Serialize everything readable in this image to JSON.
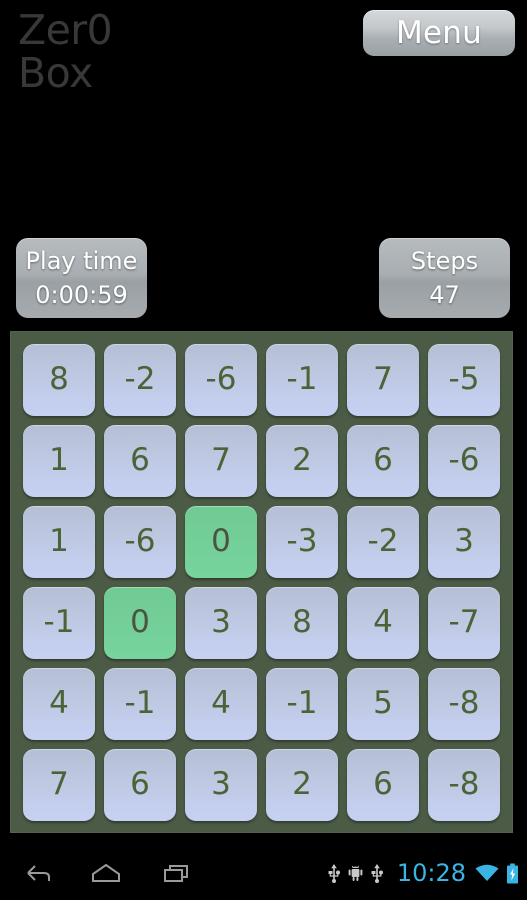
{
  "app": {
    "title_line1": "Zer0",
    "title_line2": "Box"
  },
  "header": {
    "menu_label": "Menu"
  },
  "stats": {
    "playtime_label": "Play time",
    "playtime_value": "0:00:59",
    "steps_label": "Steps",
    "steps_value": "47"
  },
  "board": {
    "rows": 6,
    "cols": 6,
    "cells": [
      [
        {
          "v": "8",
          "zero": false
        },
        {
          "v": "-2",
          "zero": false
        },
        {
          "v": "-6",
          "zero": false
        },
        {
          "v": "-1",
          "zero": false
        },
        {
          "v": "7",
          "zero": false
        },
        {
          "v": "-5",
          "zero": false
        }
      ],
      [
        {
          "v": "1",
          "zero": false
        },
        {
          "v": "6",
          "zero": false
        },
        {
          "v": "7",
          "zero": false
        },
        {
          "v": "2",
          "zero": false
        },
        {
          "v": "6",
          "zero": false
        },
        {
          "v": "-6",
          "zero": false
        }
      ],
      [
        {
          "v": "1",
          "zero": false
        },
        {
          "v": "-6",
          "zero": false
        },
        {
          "v": "0",
          "zero": true
        },
        {
          "v": "-3",
          "zero": false
        },
        {
          "v": "-2",
          "zero": false
        },
        {
          "v": "3",
          "zero": false
        }
      ],
      [
        {
          "v": "-1",
          "zero": false
        },
        {
          "v": "0",
          "zero": true
        },
        {
          "v": "3",
          "zero": false
        },
        {
          "v": "8",
          "zero": false
        },
        {
          "v": "4",
          "zero": false
        },
        {
          "v": "-7",
          "zero": false
        }
      ],
      [
        {
          "v": "4",
          "zero": false
        },
        {
          "v": "-1",
          "zero": false
        },
        {
          "v": "4",
          "zero": false
        },
        {
          "v": "-1",
          "zero": false
        },
        {
          "v": "5",
          "zero": false
        },
        {
          "v": "-8",
          "zero": false
        }
      ],
      [
        {
          "v": "7",
          "zero": false
        },
        {
          "v": "6",
          "zero": false
        },
        {
          "v": "3",
          "zero": false
        },
        {
          "v": "2",
          "zero": false
        },
        {
          "v": "6",
          "zero": false
        },
        {
          "v": "-8",
          "zero": false
        }
      ]
    ]
  },
  "navbar": {
    "back_icon": "back-arrow-icon",
    "home_icon": "home-icon",
    "recents_icon": "recents-icon",
    "status": {
      "usb_icon_1": "usb-icon",
      "android_debug_icon": "android-debug-icon",
      "usb_icon_2": "usb-icon",
      "clock": "10:28",
      "wifi_icon": "wifi-icon",
      "battery_icon": "battery-charging-icon"
    }
  },
  "colors": {
    "background": "#000000",
    "board_bg": "#4c5b45",
    "tile_bg": "#c0cae4",
    "tile_text": "#4c6338",
    "zero_tile_bg": "#73cf97",
    "panel_bg": "#a6abaf",
    "clock_accent": "#3ab4e3",
    "title_text": "#383838"
  }
}
